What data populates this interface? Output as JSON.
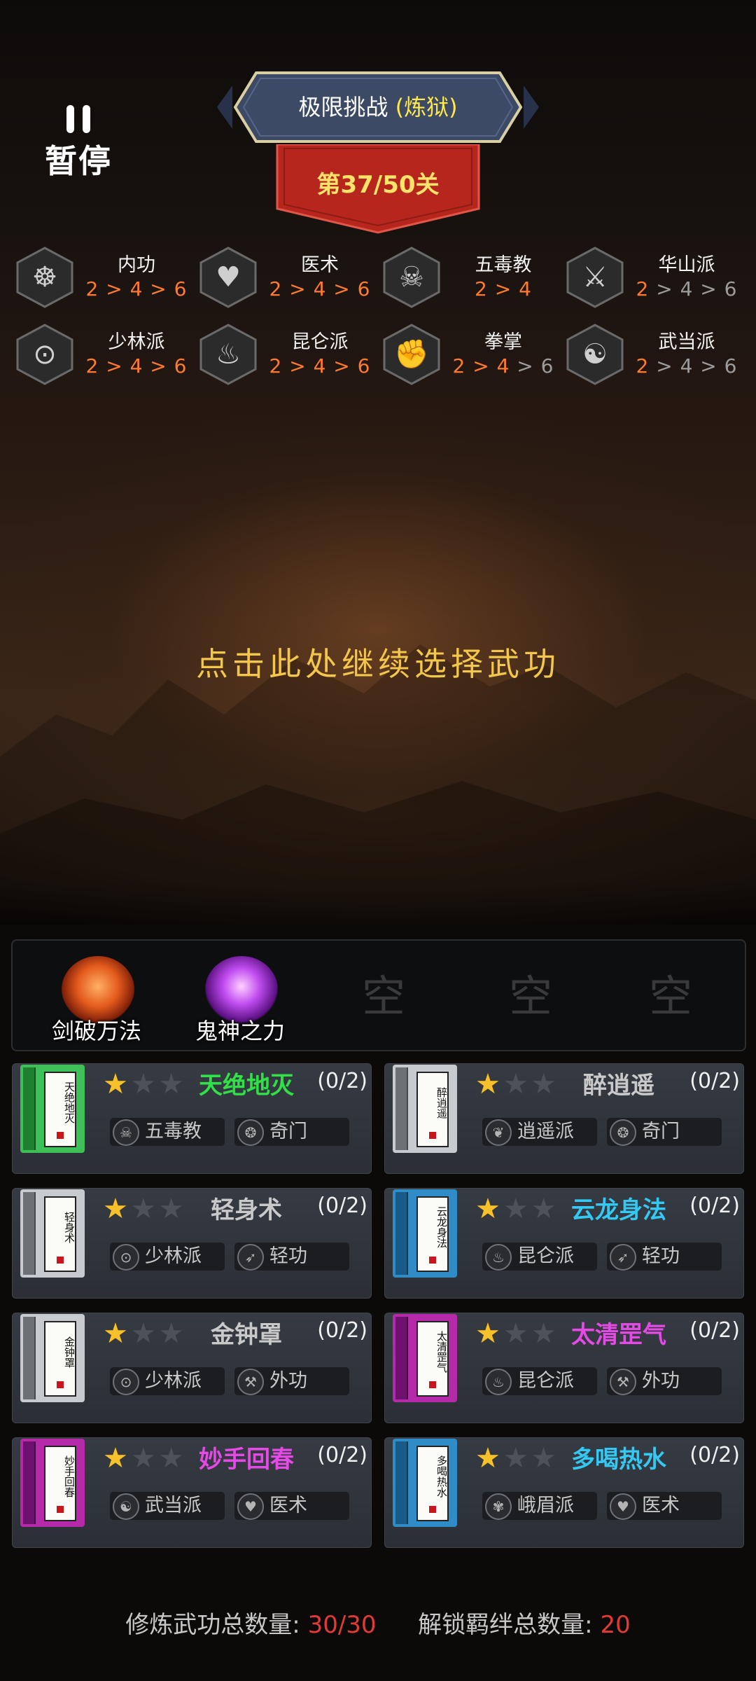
{
  "pause": {
    "label": "暂停"
  },
  "header": {
    "title_main": "极限挑战",
    "title_mode": "(炼狱)",
    "level": "第37/50关"
  },
  "bonds": [
    {
      "name": "内功",
      "icon": "meditation-icon",
      "glyph": "☸",
      "tiers_on": "2 > 4 > 6",
      "tiers_off": ""
    },
    {
      "name": "医术",
      "icon": "heart-hand-icon",
      "glyph": "♥",
      "tiers_on": "2 > 4 > 6",
      "tiers_off": ""
    },
    {
      "name": "五毒教",
      "icon": "scorpion-icon",
      "glyph": "☠",
      "tiers_on": "2 > 4",
      "tiers_off": ""
    },
    {
      "name": "华山派",
      "icon": "sword-icon",
      "glyph": "⚔",
      "tiers_on": "2",
      "tiers_off": " > 4 > 6"
    },
    {
      "name": "少林派",
      "icon": "prayer-beads-icon",
      "glyph": "⊙",
      "tiers_on": "2 > 4 > 6",
      "tiers_off": ""
    },
    {
      "name": "昆仑派",
      "icon": "flame-icon",
      "glyph": "♨",
      "tiers_on": "2 > 4 > 6",
      "tiers_off": ""
    },
    {
      "name": "拳掌",
      "icon": "fist-icon",
      "glyph": "✊",
      "tiers_on": "2 > 4",
      "tiers_off": " > 6"
    },
    {
      "name": "武当派",
      "icon": "taiji-icon",
      "glyph": "☯",
      "tiers_on": "2",
      "tiers_off": " > 4 > 6"
    }
  ],
  "prompt": "点击此处继续选择武功",
  "skill_slots": [
    {
      "label": "剑破万法",
      "empty": false
    },
    {
      "label": "鬼神之力",
      "empty": false
    },
    {
      "label": "空",
      "empty": true
    },
    {
      "label": "空",
      "empty": true
    },
    {
      "label": "空",
      "empty": true
    }
  ],
  "colors": {
    "green": "#30e046",
    "white": "#c9c9c9",
    "blue": "#34c8f2",
    "purple": "#e64ae6",
    "active_tier": "#ff7a2e",
    "inactive_tier": "#9c9c9c",
    "gold": "#f3c64c",
    "red": "#e23a35"
  },
  "skills": [
    {
      "name": "天绝地灭",
      "book_text": "天绝地灭",
      "rarity": "green",
      "stars": 1,
      "max_stars": 3,
      "progress": "(0/2)",
      "tag1": "五毒教",
      "tag1_icon": "scorpion-icon",
      "tag2": "奇门",
      "tag2_icon": "qimen-icon"
    },
    {
      "name": "醉逍遥",
      "book_text": "醉逍遥",
      "rarity": "white",
      "stars": 1,
      "max_stars": 3,
      "progress": "(0/2)",
      "tag1": "逍遥派",
      "tag1_icon": "xiaoyao-icon",
      "tag2": "奇门",
      "tag2_icon": "qimen-icon"
    },
    {
      "name": "轻身术",
      "book_text": "轻身术",
      "rarity": "white",
      "stars": 1,
      "max_stars": 3,
      "progress": "(0/2)",
      "tag1": "少林派",
      "tag1_icon": "prayer-beads-icon",
      "tag2": "轻功",
      "tag2_icon": "qinggong-icon"
    },
    {
      "name": "云龙身法",
      "book_text": "云龙身法",
      "rarity": "blue",
      "stars": 1,
      "max_stars": 3,
      "progress": "(0/2)",
      "tag1": "昆仑派",
      "tag1_icon": "flame-icon",
      "tag2": "轻功",
      "tag2_icon": "qinggong-icon"
    },
    {
      "name": "金钟罩",
      "book_text": "金钟罩",
      "rarity": "white",
      "stars": 1,
      "max_stars": 3,
      "progress": "(0/2)",
      "tag1": "少林派",
      "tag1_icon": "prayer-beads-icon",
      "tag2": "外功",
      "tag2_icon": "axe-icon"
    },
    {
      "name": "太清罡气",
      "book_text": "太清罡气",
      "rarity": "purple",
      "stars": 1,
      "max_stars": 3,
      "progress": "(0/2)",
      "tag1": "昆仑派",
      "tag1_icon": "flame-icon",
      "tag2": "外功",
      "tag2_icon": "axe-icon"
    },
    {
      "name": "妙手回春",
      "book_text": "妙手回春",
      "rarity": "purple",
      "stars": 1,
      "max_stars": 3,
      "progress": "(0/2)",
      "tag1": "武当派",
      "tag1_icon": "taiji-icon",
      "tag2": "医术",
      "tag2_icon": "heart-hand-icon"
    },
    {
      "name": "多喝热水",
      "book_text": "多喝热水",
      "rarity": "blue",
      "stars": 1,
      "max_stars": 3,
      "progress": "(0/2)",
      "tag1": "峨眉派",
      "tag1_icon": "emei-icon",
      "tag2": "医术",
      "tag2_icon": "heart-hand-icon"
    }
  ],
  "footer": {
    "trained_label": "修炼武功总数量:",
    "trained_value": "30/30",
    "bonds_label": "解锁羁绊总数量:",
    "bonds_value": "20"
  }
}
